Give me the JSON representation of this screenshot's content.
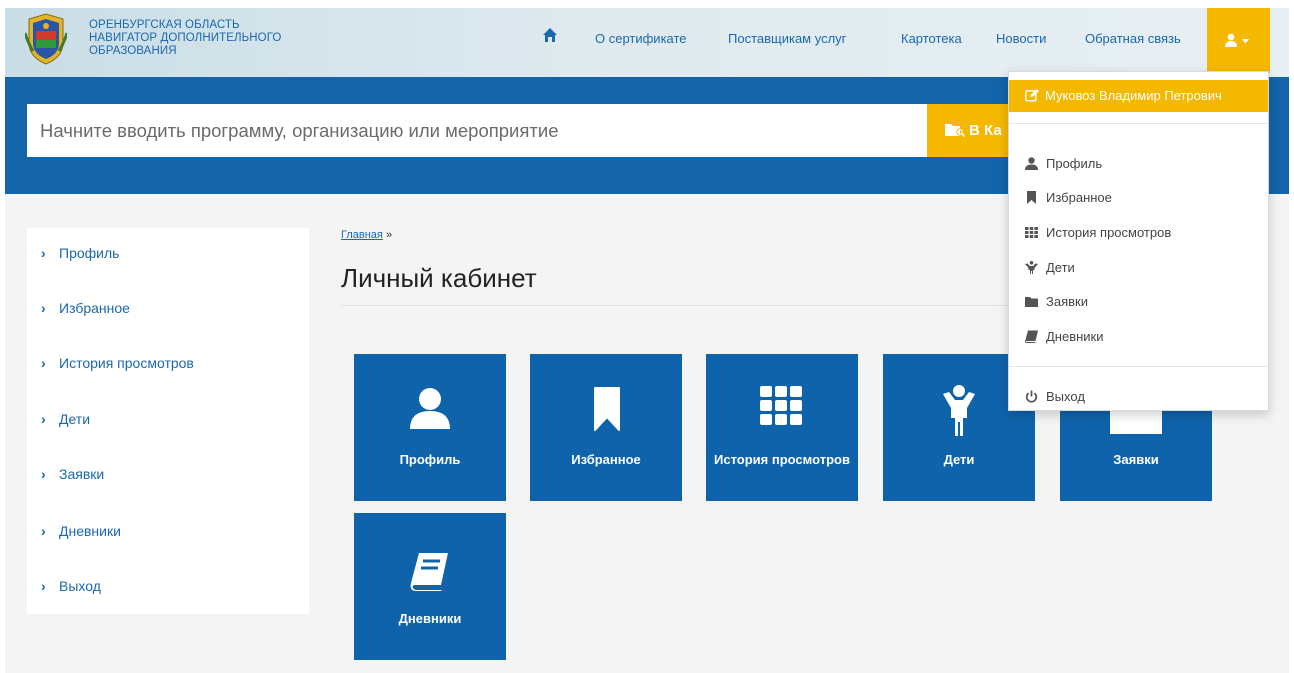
{
  "brand": {
    "line1": "ОРЕНБУРГСКАЯ ОБЛАСТЬ",
    "line2": "НАВИГАТОР ДОПОЛНИТЕЛЬНОГО",
    "line3": "ОБРАЗОВАНИЯ"
  },
  "nav": {
    "home_icon": "home-icon",
    "items": [
      {
        "label": "О сертификате"
      },
      {
        "label": "Поставщикам услуг"
      },
      {
        "label": "Картотека"
      },
      {
        "label": "Новости"
      },
      {
        "label": "Обратная связь"
      }
    ],
    "user_icon": "user-icon"
  },
  "search": {
    "placeholder": "Начните вводить программу, организацию или мероприятие",
    "button_label": "В Ка"
  },
  "sidebar": {
    "items": [
      {
        "label": "Профиль"
      },
      {
        "label": "Избранное"
      },
      {
        "label": "История просмотров"
      },
      {
        "label": "Дети"
      },
      {
        "label": "Заявки"
      },
      {
        "label": "Дневники"
      },
      {
        "label": "Выход"
      }
    ]
  },
  "breadcrumb": {
    "home": "Главная",
    "separator": "»"
  },
  "page_title": "Личный кабинет",
  "tiles": [
    {
      "label": "Профиль",
      "icon": "user-icon"
    },
    {
      "label": "Избранное",
      "icon": "bookmark-icon"
    },
    {
      "label": "История просмотров",
      "icon": "grid-icon"
    },
    {
      "label": "Дети",
      "icon": "child-icon"
    },
    {
      "label": "Заявки",
      "icon": "folder-icon"
    },
    {
      "label": "Дневники",
      "icon": "book-icon"
    }
  ],
  "dropdown": {
    "user_name": "Муковоз Владимир Петрович",
    "items": [
      {
        "label": "Профиль",
        "icon": "user-icon"
      },
      {
        "label": "Избранное",
        "icon": "bookmark-icon"
      },
      {
        "label": "История просмотров",
        "icon": "grid-icon"
      },
      {
        "label": "Дети",
        "icon": "child-icon"
      },
      {
        "label": "Заявки",
        "icon": "folder-icon"
      },
      {
        "label": "Дневники",
        "icon": "book-icon"
      }
    ],
    "logout": "Выход"
  },
  "colors": {
    "primary_blue": "#1364a9",
    "tile_blue": "#0f63ab",
    "accent_yellow": "#f5b800",
    "link_blue": "#1a68ad",
    "background": "#f4f4f4"
  }
}
